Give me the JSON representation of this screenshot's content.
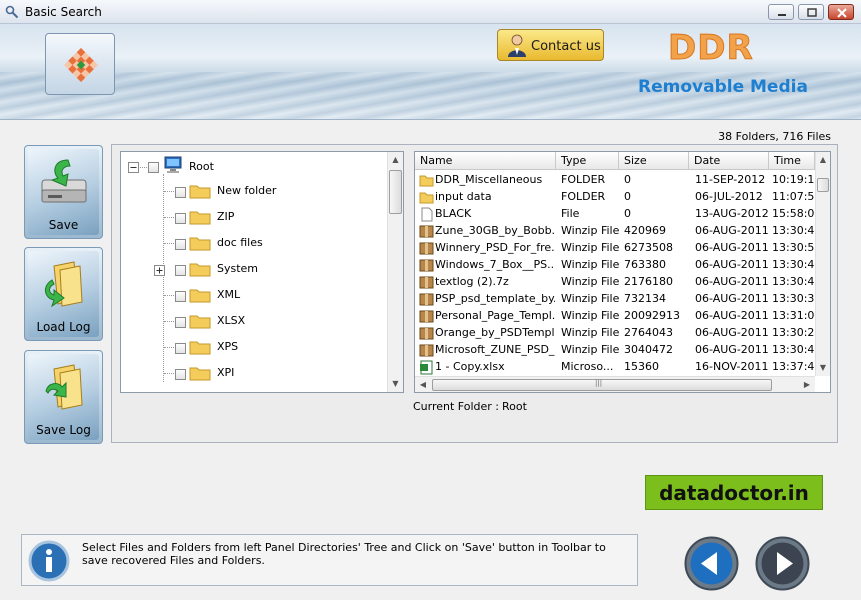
{
  "window": {
    "title": "Basic Search"
  },
  "banner": {
    "contact_label": "Contact us",
    "brand": "DDR",
    "product": "Removable Media"
  },
  "summary": {
    "count_text": "38 Folders, 716 Files"
  },
  "toolbar": {
    "save_label": "Save",
    "load_log_label": "Load Log",
    "save_log_label": "Save Log"
  },
  "tree": {
    "root": "Root",
    "items": [
      {
        "label": "New folder",
        "expandable": false
      },
      {
        "label": "ZIP",
        "expandable": false
      },
      {
        "label": "doc files",
        "expandable": false
      },
      {
        "label": "System",
        "expandable": true
      },
      {
        "label": "XML",
        "expandable": false
      },
      {
        "label": "XLSX",
        "expandable": false
      },
      {
        "label": "XPS",
        "expandable": false
      },
      {
        "label": "XPI",
        "expandable": false
      }
    ]
  },
  "list": {
    "columns": [
      "Name",
      "Type",
      "Size",
      "Date",
      "Time"
    ],
    "rows": [
      {
        "icon": "folder",
        "name": "DDR_Miscellaneous",
        "type": "FOLDER",
        "size": "0",
        "date": "11-SEP-2012",
        "time": "10:19:1"
      },
      {
        "icon": "folder",
        "name": "input data",
        "type": "FOLDER",
        "size": "0",
        "date": "06-JUL-2012",
        "time": "11:07:5"
      },
      {
        "icon": "file",
        "name": "BLACK",
        "type": "File",
        "size": "0",
        "date": "13-AUG-2012",
        "time": "15:58:0"
      },
      {
        "icon": "zip",
        "name": "Zune_30GB_by_Bobb...",
        "type": "Winzip File",
        "size": "420969",
        "date": "06-AUG-2011",
        "time": "13:30:4"
      },
      {
        "icon": "zip",
        "name": "Winnery_PSD_For_fre...",
        "type": "Winzip File",
        "size": "6273508",
        "date": "06-AUG-2011",
        "time": "13:30:5"
      },
      {
        "icon": "zip",
        "name": "Windows_7_Box__PS...",
        "type": "Winzip File",
        "size": "763380",
        "date": "06-AUG-2011",
        "time": "13:30:4"
      },
      {
        "icon": "zip",
        "name": "textlog (2).7z",
        "type": "Winzip File",
        "size": "2176180",
        "date": "06-AUG-2011",
        "time": "13:30:4"
      },
      {
        "icon": "zip",
        "name": "PSP_psd_template_by...",
        "type": "Winzip File",
        "size": "732134",
        "date": "06-AUG-2011",
        "time": "13:30:3"
      },
      {
        "icon": "zip",
        "name": "Personal_Page_Templ...",
        "type": "Winzip File",
        "size": "20092913",
        "date": "06-AUG-2011",
        "time": "13:31:0"
      },
      {
        "icon": "zip",
        "name": "Orange_by_PSDTempl...",
        "type": "Winzip File",
        "size": "2764043",
        "date": "06-AUG-2011",
        "time": "13:30:2"
      },
      {
        "icon": "zip",
        "name": "Microsoft_ZUNE_PSD_...",
        "type": "Winzip File",
        "size": "3040472",
        "date": "06-AUG-2011",
        "time": "13:30:4"
      },
      {
        "icon": "xlsx",
        "name": "1 - Copy.xlsx",
        "type": "Microso...",
        "size": "15360",
        "date": "16-NOV-2011",
        "time": "13:37:4"
      }
    ]
  },
  "current_folder": {
    "label": "Current Folder :",
    "value": "Root"
  },
  "watermark": "datadoctor.in",
  "info": {
    "text": "Select Files and Folders from left Panel Directories' Tree and Click on 'Save' button in Toolbar to save recovered Files and Folders."
  },
  "colors": {
    "accent": "#1e7fd0",
    "brand_orange": "#f1a24a",
    "site_green": "#7cbf1d"
  }
}
